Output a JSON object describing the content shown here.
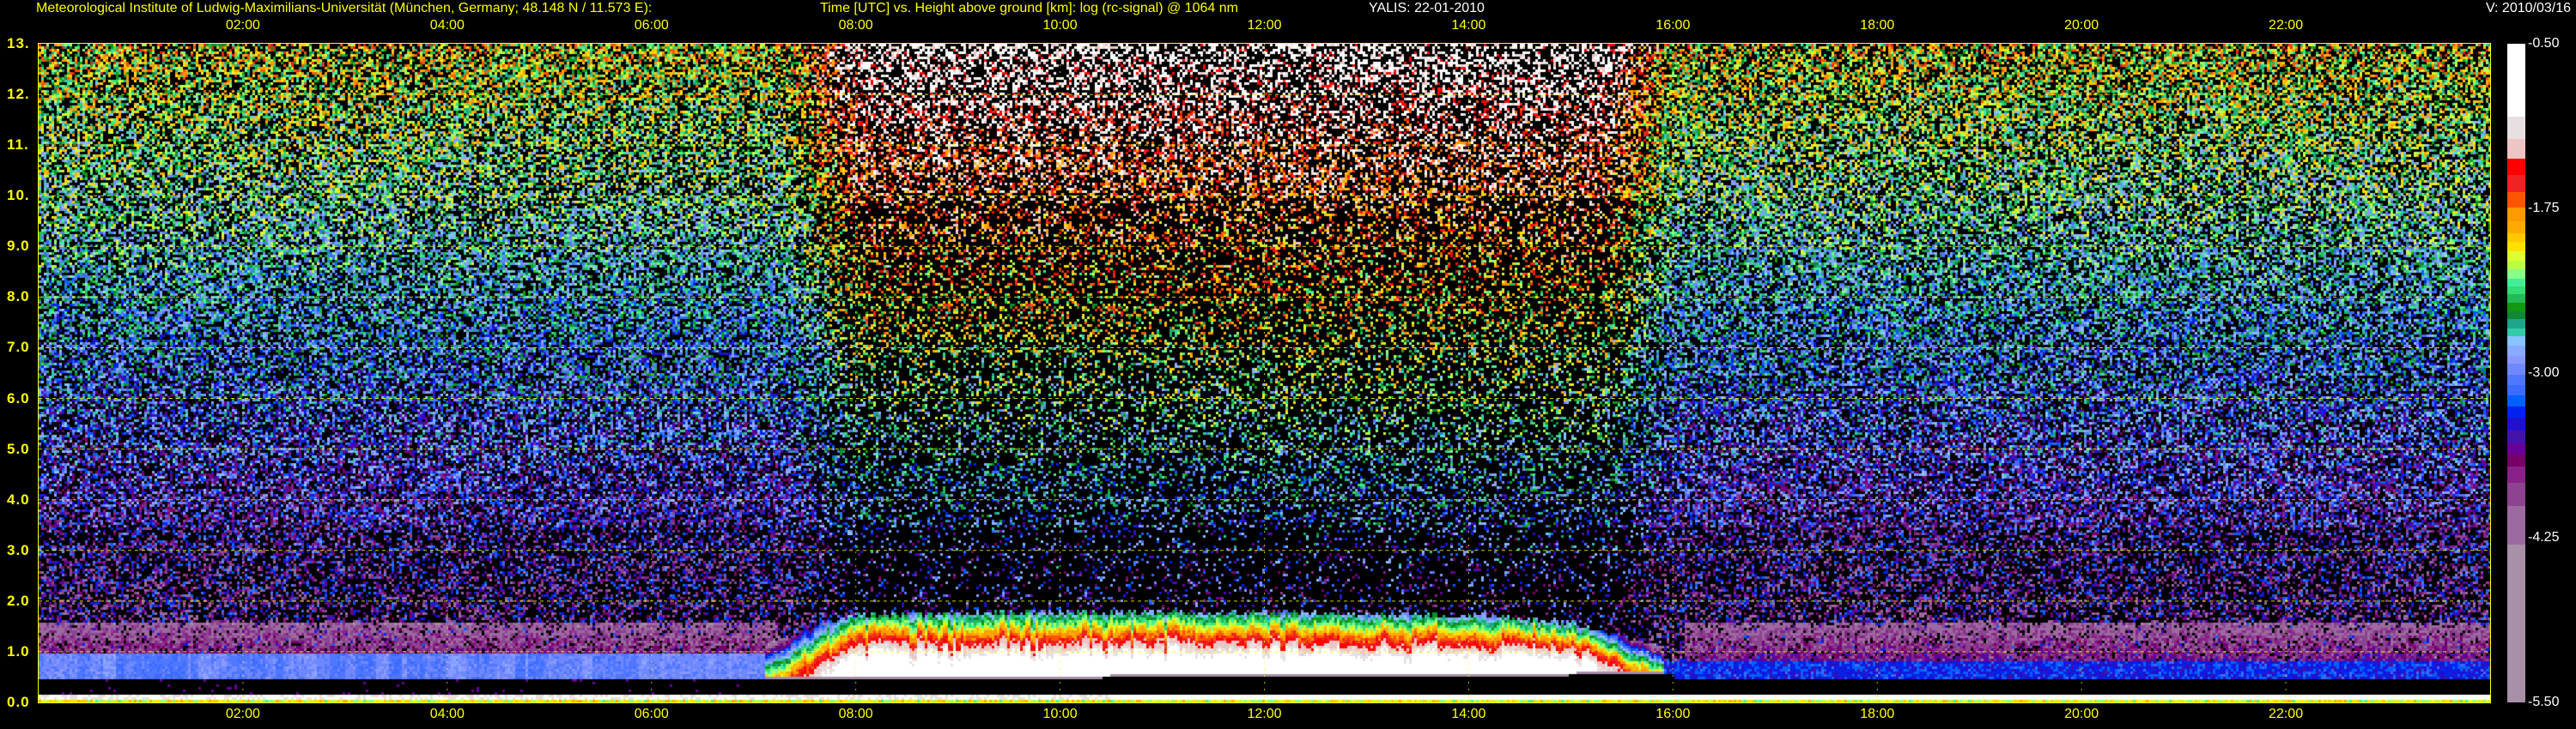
{
  "header": {
    "institute": "Meteorological Institute of Ludwig-Maximilians-Universität (München, Germany; 48.148 N / 11.573 E):",
    "description": "Time [UTC] vs. Height above ground [km]: log (rc-signal) @ 1064 nm",
    "instrument": "YALIS: 22-01-2010",
    "version": "V: 2010/03/16"
  },
  "chart_data": {
    "type": "heatmap",
    "title": "Time [UTC] vs. Height above ground [km]: log (rc-signal) @ 1064 nm",
    "xlabel": "Time [UTC]",
    "ylabel": "Height above ground [km]",
    "xlim_hours": [
      0,
      24
    ],
    "ylim": [
      0,
      13
    ],
    "grid": true,
    "x_ticks": [
      {
        "hour": 2,
        "label": "02:00"
      },
      {
        "hour": 4,
        "label": "04:00"
      },
      {
        "hour": 6,
        "label": "06:00"
      },
      {
        "hour": 8,
        "label": "08:00"
      },
      {
        "hour": 10,
        "label": "10:00"
      },
      {
        "hour": 12,
        "label": "12:00"
      },
      {
        "hour": 14,
        "label": "14:00"
      },
      {
        "hour": 16,
        "label": "16:00"
      },
      {
        "hour": 18,
        "label": "18:00"
      },
      {
        "hour": 20,
        "label": "20:00"
      },
      {
        "hour": 22,
        "label": "22:00"
      }
    ],
    "y_ticks": [
      {
        "km": 0,
        "label": "0.0"
      },
      {
        "km": 1,
        "label": "1.0"
      },
      {
        "km": 2,
        "label": "2.0"
      },
      {
        "km": 3,
        "label": "3.0"
      },
      {
        "km": 4,
        "label": "4.0"
      },
      {
        "km": 5,
        "label": "5.0"
      },
      {
        "km": 6,
        "label": "6.0"
      },
      {
        "km": 7,
        "label": "7.0"
      },
      {
        "km": 8,
        "label": "8.0"
      },
      {
        "km": 9,
        "label": "9.0"
      },
      {
        "km": 10,
        "label": "10."
      },
      {
        "km": 11,
        "label": "11."
      },
      {
        "km": 12,
        "label": "12."
      },
      {
        "km": 13,
        "label": "13."
      }
    ],
    "colorbar": {
      "range": [
        -5.5,
        -0.5
      ],
      "ticks": [
        {
          "value": -0.5,
          "label": "-0.50"
        },
        {
          "value": -1.75,
          "label": "-1.75"
        },
        {
          "value": -3.0,
          "label": "-3.00"
        },
        {
          "value": -4.25,
          "label": "-4.25"
        },
        {
          "value": -5.5,
          "label": "-5.50"
        }
      ],
      "stops": [
        {
          "from": -1.054,
          "to": -0.5,
          "color": "#ffffff"
        },
        {
          "from": -1.223,
          "to": -1.054,
          "color": "#e8e0e0"
        },
        {
          "from": -1.372,
          "to": -1.223,
          "color": "#eec4c4"
        },
        {
          "from": -1.495,
          "to": -1.372,
          "color": "#ff0000"
        },
        {
          "from": -1.626,
          "to": -1.495,
          "color": "#ee2222"
        },
        {
          "from": -1.742,
          "to": -1.626,
          "color": "#ff5500"
        },
        {
          "from": -1.848,
          "to": -1.742,
          "color": "#ff9900"
        },
        {
          "from": -1.936,
          "to": -1.848,
          "color": "#ffaa00"
        },
        {
          "from": -2.007,
          "to": -1.936,
          "color": "#ffc800"
        },
        {
          "from": -2.077,
          "to": -2.007,
          "color": "#ffe000"
        },
        {
          "from": -2.148,
          "to": -2.077,
          "color": "#ddff33"
        },
        {
          "from": -2.211,
          "to": -2.148,
          "color": "#bbff44"
        },
        {
          "from": -2.282,
          "to": -2.211,
          "color": "#88ff88"
        },
        {
          "from": -2.342,
          "to": -2.282,
          "color": "#44ee99"
        },
        {
          "from": -2.402,
          "to": -2.342,
          "color": "#33dd77"
        },
        {
          "from": -2.465,
          "to": -2.402,
          "color": "#22bb55"
        },
        {
          "from": -2.529,
          "to": -2.465,
          "color": "#119911"
        },
        {
          "from": -2.589,
          "to": -2.529,
          "color": "#118833"
        },
        {
          "from": -2.659,
          "to": -2.589,
          "color": "#1fa58a"
        },
        {
          "from": -2.719,
          "to": -2.659,
          "color": "#33ccaa"
        },
        {
          "from": -2.79,
          "to": -2.719,
          "color": "#88c4ff"
        },
        {
          "from": -2.871,
          "to": -2.79,
          "color": "#88aaff"
        },
        {
          "from": -2.931,
          "to": -2.871,
          "color": "#8899ff"
        },
        {
          "from": -3.012,
          "to": -2.931,
          "color": "#6f88ff"
        },
        {
          "from": -3.093,
          "to": -3.012,
          "color": "#4f77ff"
        },
        {
          "from": -3.171,
          "to": -3.093,
          "color": "#3c6cff"
        },
        {
          "from": -3.252,
          "to": -3.171,
          "color": "#0060ff"
        },
        {
          "from": -3.341,
          "to": -3.252,
          "color": "#0022ee"
        },
        {
          "from": -3.436,
          "to": -3.341,
          "color": "#2211cc"
        },
        {
          "from": -3.531,
          "to": -3.436,
          "color": "#4411aa"
        },
        {
          "from": -3.619,
          "to": -3.531,
          "color": "#660099"
        },
        {
          "from": -3.711,
          "to": -3.619,
          "color": "#770066"
        },
        {
          "from": -3.835,
          "to": -3.711,
          "color": "#882288"
        },
        {
          "from": -4.011,
          "to": -3.835,
          "color": "#8c4490"
        },
        {
          "from": -4.3,
          "to": -4.011,
          "color": "#9c6aa0"
        },
        {
          "from": -5.5,
          "to": -4.3,
          "color": "#a890a8"
        }
      ]
    },
    "aerosol_layer_top_km": {
      "hours": [
        0,
        6,
        7,
        7.5,
        8,
        10,
        12,
        14,
        15,
        15.5,
        16,
        20,
        24
      ],
      "values": [
        1.0,
        1.0,
        1.0,
        1.5,
        1.75,
        1.8,
        1.8,
        1.75,
        1.6,
        1.3,
        1.0,
        1.0,
        1.0
      ]
    },
    "grid_color": "#ffff00"
  }
}
